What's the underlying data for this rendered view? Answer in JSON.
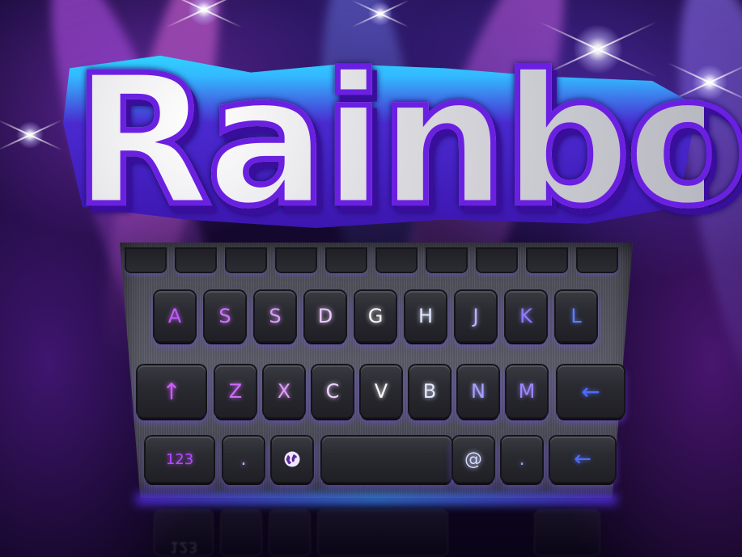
{
  "title": {
    "text": "Rainbow"
  },
  "keyboard": {
    "row_home": [
      {
        "label": "A",
        "name": "key-a",
        "color": "#c25bff"
      },
      {
        "label": "S",
        "name": "key-s",
        "color": "#cf74ff"
      },
      {
        "label": "S",
        "name": "key-s-2",
        "color": "#d99bff"
      },
      {
        "label": "D",
        "name": "key-d",
        "color": "#e9c7ff"
      },
      {
        "label": "G",
        "name": "key-g",
        "color": "#f4f4f4"
      },
      {
        "label": "H",
        "name": "key-h",
        "color": "#dfe6ff"
      },
      {
        "label": "J",
        "name": "key-j",
        "color": "#bcb2ff"
      },
      {
        "label": "K",
        "name": "key-k",
        "color": "#8c7cff"
      },
      {
        "label": "L",
        "name": "key-l",
        "color": "#5f7dff"
      }
    ],
    "row_bottom_letters": [
      {
        "label": "↑",
        "name": "key-shift",
        "color": "#d05bff",
        "icon": "shift-arrow-icon"
      },
      {
        "label": "Z",
        "name": "key-z",
        "color": "#d06bff"
      },
      {
        "label": "X",
        "name": "key-x",
        "color": "#e29bff"
      },
      {
        "label": "C",
        "name": "key-c",
        "color": "#f0d2ff"
      },
      {
        "label": "V",
        "name": "key-v",
        "color": "#f6f6f6"
      },
      {
        "label": "B",
        "name": "key-b",
        "color": "#e3e6ff"
      },
      {
        "label": "N",
        "name": "key-n",
        "color": "#a9a0ff"
      },
      {
        "label": "M",
        "name": "key-m",
        "color": "#9d86ff"
      },
      {
        "label": "←",
        "name": "key-backspace",
        "color": "#4d6cff",
        "icon": "backspace-arrow-icon"
      }
    ],
    "row_function": [
      {
        "label": "123",
        "name": "key-numbers",
        "color": "#b44bff"
      },
      {
        "label": ".",
        "name": "key-period",
        "color": "#d6a7ff"
      },
      {
        "label": "",
        "name": "key-globe",
        "color": "#e9d6ff",
        "icon": "globe-icon"
      },
      {
        "label": "",
        "name": "key-space",
        "color": "#cccccc"
      },
      {
        "label": "@",
        "name": "key-at",
        "color": "#d2d8ff"
      },
      {
        "label": ".",
        "name": "key-period-2",
        "color": "#9b9bff"
      },
      {
        "label": "←",
        "name": "key-enter",
        "color": "#4d6cff",
        "icon": "enter-arrow-icon"
      }
    ],
    "accent_colors": {
      "purple": "#7a2cff",
      "cyan_glow": "#2ee6ff",
      "blue": "#3a8cff"
    }
  },
  "reflection": {
    "labels": [
      "123",
      "",
      "",
      "",
      ""
    ]
  }
}
